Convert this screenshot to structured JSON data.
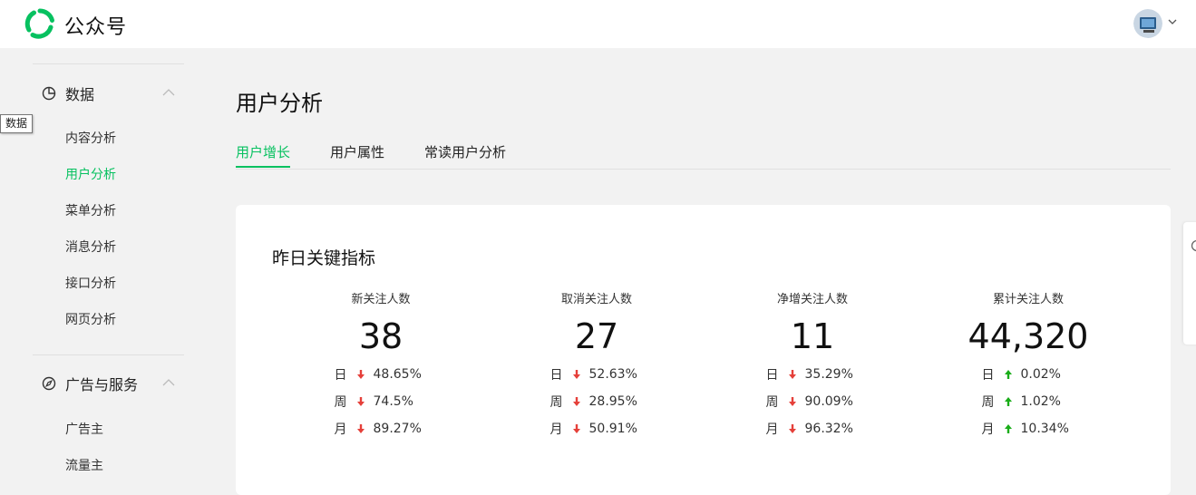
{
  "app": {
    "brand": "公众号"
  },
  "sidebar": {
    "groups": [
      {
        "title": "数据",
        "icon": "pie-chart-icon",
        "items": [
          {
            "label": "内容分析",
            "active": false
          },
          {
            "label": "用户分析",
            "active": true
          },
          {
            "label": "菜单分析",
            "active": false
          },
          {
            "label": "消息分析",
            "active": false
          },
          {
            "label": "接口分析",
            "active": false
          },
          {
            "label": "网页分析",
            "active": false
          }
        ]
      },
      {
        "title": "广告与服务",
        "icon": "compass-icon",
        "items": [
          {
            "label": "广告主",
            "active": false
          },
          {
            "label": "流量主",
            "active": false
          }
        ]
      }
    ],
    "tooltip": "数据"
  },
  "main": {
    "page_title": "用户分析",
    "tabs": [
      {
        "label": "用户增长",
        "active": true
      },
      {
        "label": "用户属性",
        "active": false
      },
      {
        "label": "常读用户分析",
        "active": false
      }
    ],
    "card": {
      "title": "昨日关键指标",
      "metrics": [
        {
          "label": "新关注人数",
          "value": "38",
          "changes": [
            {
              "period": "日",
              "direction": "down",
              "pct": "48.65%"
            },
            {
              "period": "周",
              "direction": "down",
              "pct": "74.5%"
            },
            {
              "period": "月",
              "direction": "down",
              "pct": "89.27%"
            }
          ]
        },
        {
          "label": "取消关注人数",
          "value": "27",
          "changes": [
            {
              "period": "日",
              "direction": "down",
              "pct": "52.63%"
            },
            {
              "period": "周",
              "direction": "down",
              "pct": "28.95%"
            },
            {
              "period": "月",
              "direction": "down",
              "pct": "50.91%"
            }
          ]
        },
        {
          "label": "净增关注人数",
          "value": "11",
          "changes": [
            {
              "period": "日",
              "direction": "down",
              "pct": "35.29%"
            },
            {
              "period": "周",
              "direction": "down",
              "pct": "90.09%"
            },
            {
              "period": "月",
              "direction": "down",
              "pct": "96.32%"
            }
          ]
        },
        {
          "label": "累计关注人数",
          "value": "44,320",
          "changes": [
            {
              "period": "日",
              "direction": "up",
              "pct": "0.02%"
            },
            {
              "period": "周",
              "direction": "up",
              "pct": "1.02%"
            },
            {
              "period": "月",
              "direction": "up",
              "pct": "10.34%"
            }
          ]
        }
      ]
    }
  },
  "colors": {
    "accent": "#07c160",
    "down": "#e5403a",
    "up": "#1aad19"
  }
}
